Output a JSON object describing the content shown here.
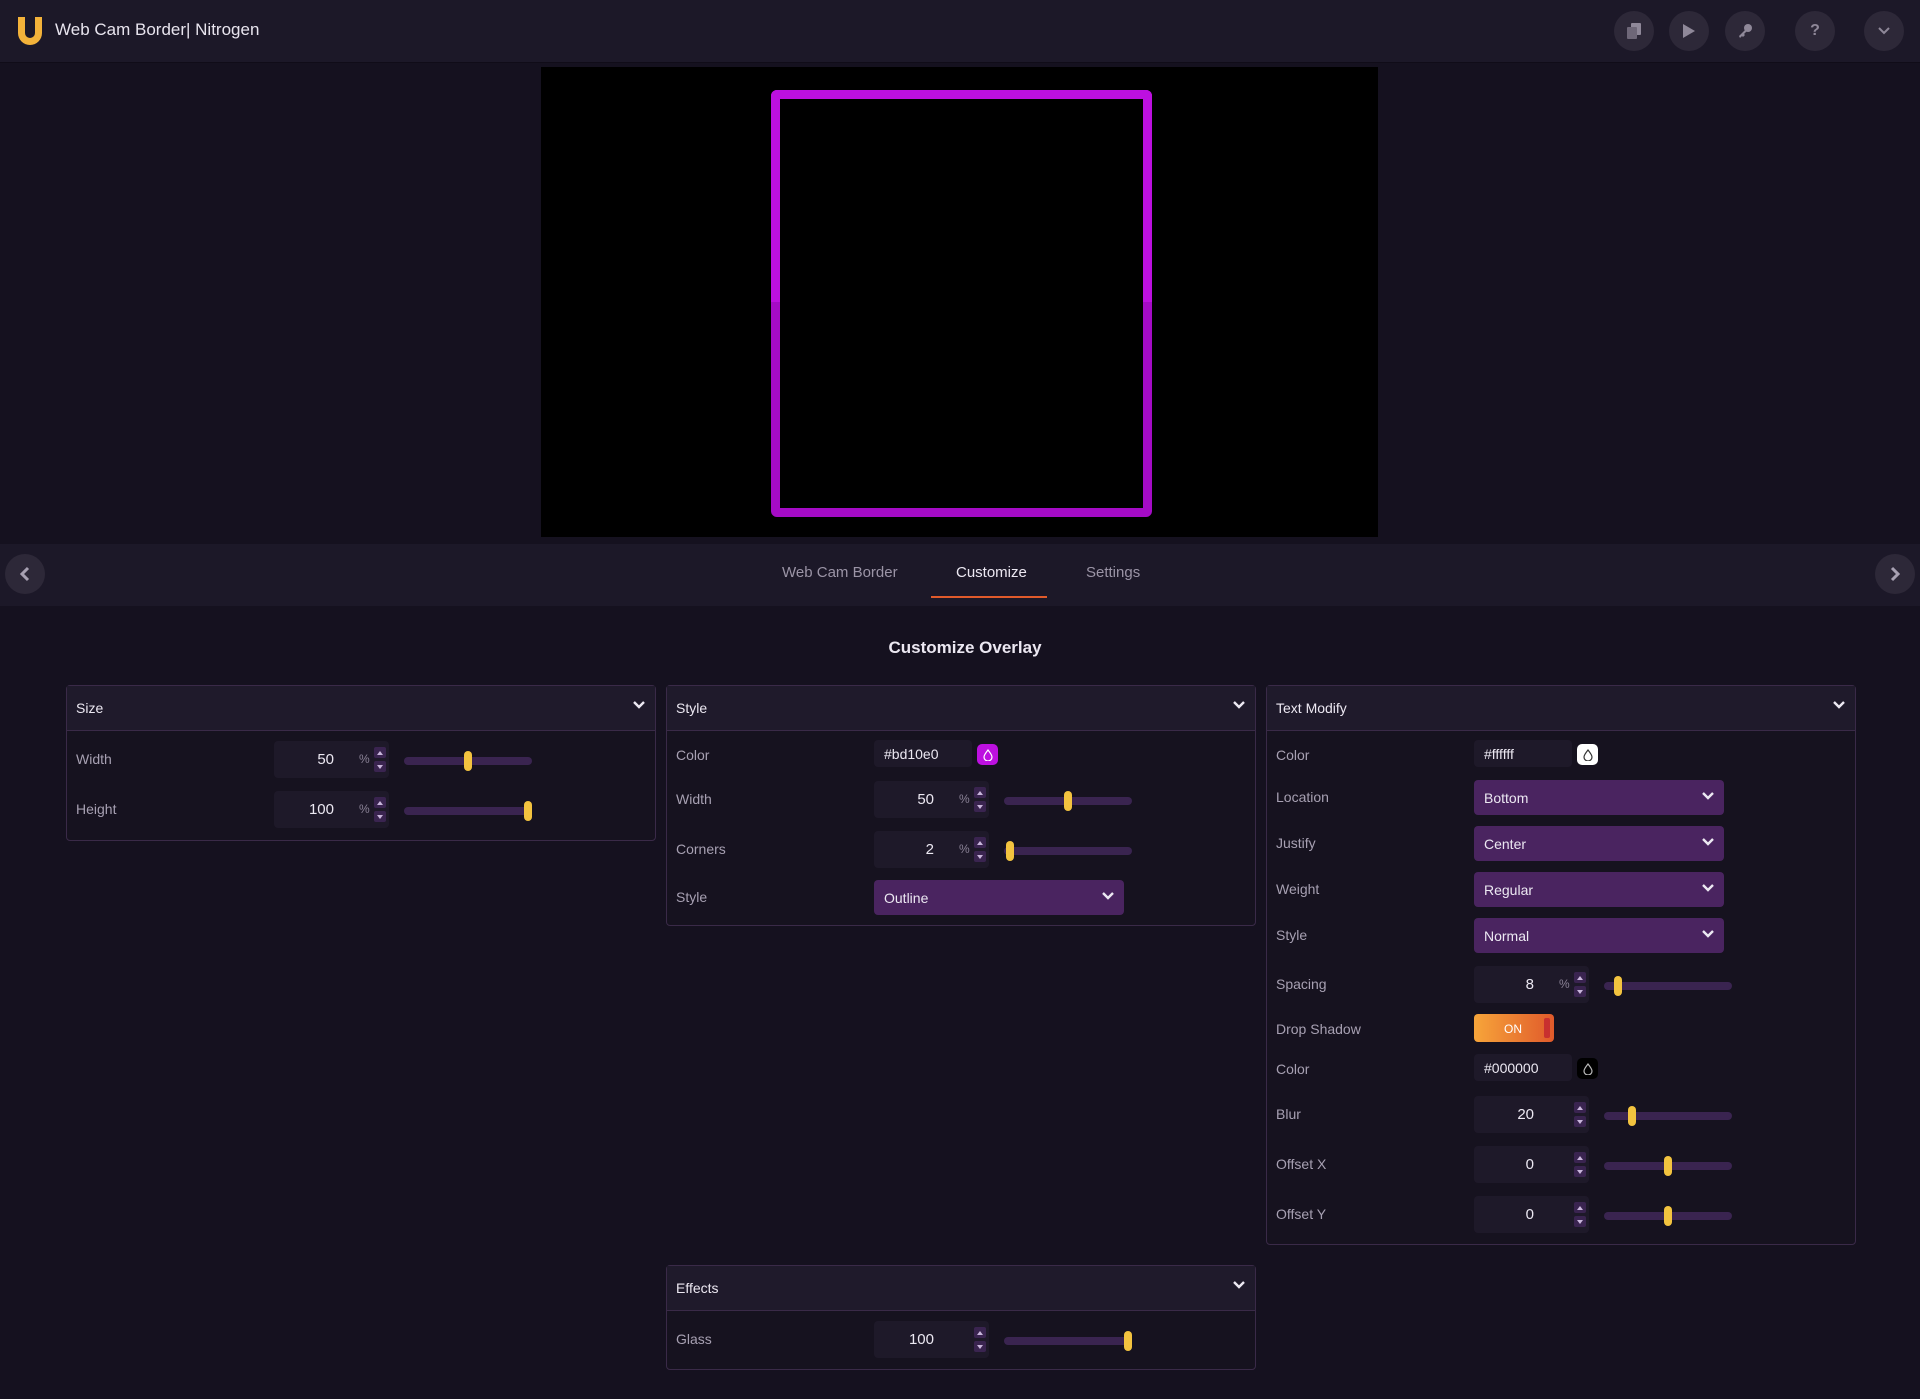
{
  "app": {
    "title": "Web Cam Border| Nitrogen",
    "logo_icon": "u-logo",
    "accent_color": "#f3c33f",
    "border_color": "#bd10e0"
  },
  "toolbar": {
    "buttons": [
      {
        "name": "copy-icon"
      },
      {
        "name": "play-icon"
      },
      {
        "name": "key-icon"
      },
      {
        "name": "help-icon",
        "glyph": "?"
      },
      {
        "name": "chevron-down-icon"
      }
    ]
  },
  "tabs": [
    {
      "label": "Web Cam Border",
      "active": false
    },
    {
      "label": "Customize",
      "active": true
    },
    {
      "label": "Settings",
      "active": false
    }
  ],
  "main": {
    "title": "Customize Overlay"
  },
  "size_panel": {
    "title": "Size",
    "width": {
      "label": "Width",
      "value": "50",
      "unit": "%",
      "level": 0.5
    },
    "height": {
      "label": "Height",
      "value": "100",
      "unit": "%",
      "level": 1.0
    }
  },
  "style_panel": {
    "title": "Style",
    "color": {
      "label": "Color",
      "value": "#bd10e0"
    },
    "width": {
      "label": "Width",
      "value": "50",
      "unit": "%",
      "level": 0.5
    },
    "corners": {
      "label": "Corners",
      "value": "2",
      "unit": "%",
      "level": 0.02
    },
    "style": {
      "label": "Style",
      "value": "Outline"
    }
  },
  "text_panel": {
    "title": "Text Modify",
    "color": {
      "label": "Color",
      "value": "#ffffff"
    },
    "location": {
      "label": "Location",
      "value": "Bottom"
    },
    "justify": {
      "label": "Justify",
      "value": "Center"
    },
    "weight": {
      "label": "Weight",
      "value": "Regular"
    },
    "style": {
      "label": "Style",
      "value": "Normal"
    },
    "spacing": {
      "label": "Spacing",
      "value": "8",
      "unit": "%",
      "level": 0.08
    },
    "drop_shadow": {
      "label": "Drop Shadow",
      "value": "ON"
    },
    "shadow_color": {
      "label": "Color",
      "value": "#000000"
    },
    "blur": {
      "label": "Blur",
      "value": "20",
      "level": 0.2
    },
    "offset_x": {
      "label": "Offset X",
      "value": "0",
      "level": 0.5
    },
    "offset_y": {
      "label": "Offset Y",
      "value": "0",
      "level": 0.5
    }
  },
  "effects_panel": {
    "title": "Effects",
    "glass": {
      "label": "Glass",
      "value": "100",
      "level": 1.0
    }
  }
}
